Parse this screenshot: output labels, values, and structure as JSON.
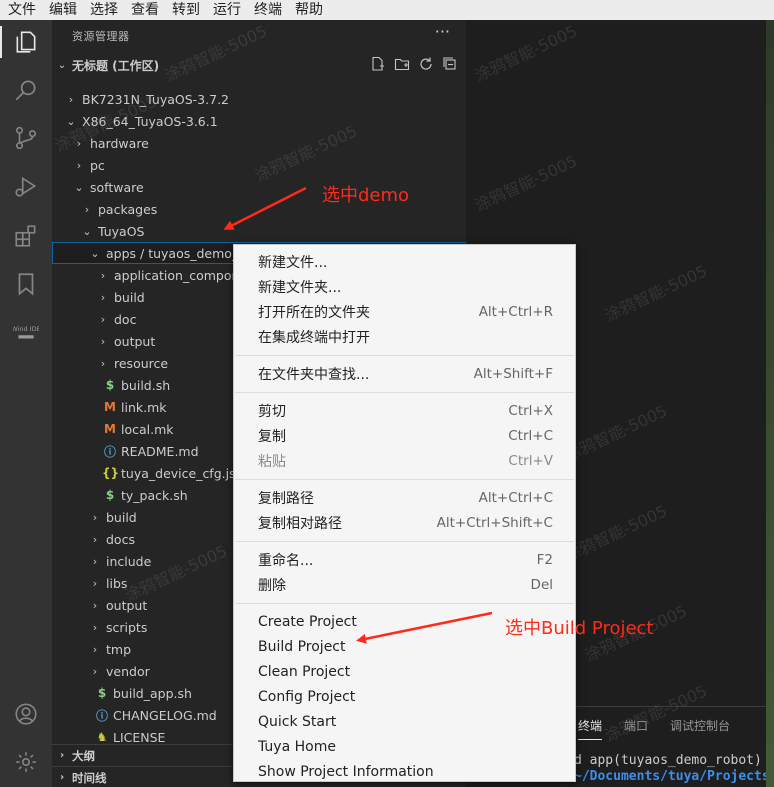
{
  "menubar": {
    "items": [
      "文件",
      "编辑",
      "选择",
      "查看",
      "转到",
      "运行",
      "终端",
      "帮助"
    ]
  },
  "activitybar": {
    "items": [
      "explorer-icon",
      "search-icon",
      "source-control-icon",
      "run-debug-icon",
      "extensions-icon",
      "bookmarks-icon",
      "wind-ide-icon",
      "account-icon",
      "settings-gear-icon"
    ],
    "wind_ide_label": "Wind IDE"
  },
  "sidebar": {
    "title": "资源管理器",
    "more": "···",
    "workspace": "无标题 (工作区)",
    "tree": [
      {
        "label": "BK7231N_TuyaOS-3.7.2",
        "chevron": "›",
        "icon": "",
        "indent": 0
      },
      {
        "label": "X86_64_TuyaOS-3.6.1",
        "chevron": "⌄",
        "icon": "",
        "indent": 0
      },
      {
        "label": "hardware",
        "chevron": "›",
        "icon": "",
        "indent": 1
      },
      {
        "label": "pc",
        "chevron": "›",
        "icon": "",
        "indent": 1
      },
      {
        "label": "software",
        "chevron": "⌄",
        "icon": "",
        "indent": 1
      },
      {
        "label": "packages",
        "chevron": "›",
        "icon": "",
        "indent": 2
      },
      {
        "label": "TuyaOS",
        "chevron": "⌄",
        "icon": "",
        "indent": 2
      },
      {
        "label": "apps / tuyaos_demo_robot",
        "chevron": "⌄",
        "icon": "",
        "indent": 3
      },
      {
        "label": "application_compor",
        "chevron": "›",
        "icon": "",
        "indent": 4
      },
      {
        "label": "build",
        "chevron": "›",
        "icon": "",
        "indent": 4
      },
      {
        "label": "doc",
        "chevron": "›",
        "icon": "",
        "indent": 4
      },
      {
        "label": "output",
        "chevron": "›",
        "icon": "",
        "indent": 4
      },
      {
        "label": "resource",
        "chevron": "›",
        "icon": "",
        "indent": 4
      },
      {
        "label": "build.sh",
        "chevron": "",
        "icon": "$",
        "indent": 4
      },
      {
        "label": "link.mk",
        "chevron": "",
        "icon": "M",
        "indent": 4
      },
      {
        "label": "local.mk",
        "chevron": "",
        "icon": "M",
        "indent": 4
      },
      {
        "label": "README.md",
        "chevron": "",
        "icon": "ⓘ",
        "indent": 4
      },
      {
        "label": "tuya_device_cfg.jso",
        "chevron": "",
        "icon": "{}",
        "indent": 4
      },
      {
        "label": "ty_pack.sh",
        "chevron": "",
        "icon": "$",
        "indent": 4
      },
      {
        "label": "build",
        "chevron": "›",
        "icon": "",
        "indent": 3
      },
      {
        "label": "docs",
        "chevron": "›",
        "icon": "",
        "indent": 3
      },
      {
        "label": "include",
        "chevron": "›",
        "icon": "",
        "indent": 3
      },
      {
        "label": "libs",
        "chevron": "›",
        "icon": "",
        "indent": 3
      },
      {
        "label": "output",
        "chevron": "›",
        "icon": "",
        "indent": 3
      },
      {
        "label": "scripts",
        "chevron": "›",
        "icon": "",
        "indent": 3
      },
      {
        "label": "tmp",
        "chevron": "›",
        "icon": "",
        "indent": 3
      },
      {
        "label": "vendor",
        "chevron": "›",
        "icon": "",
        "indent": 3
      },
      {
        "label": "build_app.sh",
        "chevron": "",
        "icon": "$",
        "indent": 3
      },
      {
        "label": "CHANGELOG.md",
        "chevron": "",
        "icon": "ⓘ",
        "indent": 3
      },
      {
        "label": "LICENSE",
        "chevron": "",
        "icon": "♞",
        "indent": 3
      }
    ],
    "panels": [
      "大纲",
      "时间线"
    ]
  },
  "panel": {
    "tabs": [
      "终端",
      "端口",
      "调试控制台"
    ],
    "terminal_line1": "d app(tuyaos_demo_robot)",
    "terminal_line2": "~/Documents/tuya/Projects"
  },
  "context_menu": {
    "groups": [
      [
        {
          "label": "新建文件...",
          "shortcut": ""
        },
        {
          "label": "新建文件夹...",
          "shortcut": ""
        },
        {
          "label": "打开所在的文件夹",
          "shortcut": "Alt+Ctrl+R"
        },
        {
          "label": "在集成终端中打开",
          "shortcut": ""
        }
      ],
      [
        {
          "label": "在文件夹中查找...",
          "shortcut": "Alt+Shift+F"
        }
      ],
      [
        {
          "label": "剪切",
          "shortcut": "Ctrl+X"
        },
        {
          "label": "复制",
          "shortcut": "Ctrl+C"
        },
        {
          "label": "粘贴",
          "shortcut": "Ctrl+V",
          "disabled": true
        }
      ],
      [
        {
          "label": "复制路径",
          "shortcut": "Alt+Ctrl+C"
        },
        {
          "label": "复制相对路径",
          "shortcut": "Alt+Ctrl+Shift+C"
        }
      ],
      [
        {
          "label": "重命名...",
          "shortcut": "F2"
        },
        {
          "label": "删除",
          "shortcut": "Del"
        }
      ],
      [
        {
          "label": "Create Project",
          "shortcut": ""
        },
        {
          "label": "Build Project",
          "shortcut": ""
        },
        {
          "label": "Clean Project",
          "shortcut": ""
        },
        {
          "label": "Config Project",
          "shortcut": ""
        },
        {
          "label": "Quick Start",
          "shortcut": ""
        },
        {
          "label": "Tuya Home",
          "shortcut": ""
        },
        {
          "label": "Show Project Information",
          "shortcut": ""
        }
      ]
    ]
  },
  "annotations": {
    "select_demo": "选中demo",
    "select_build": "选中Build Project"
  },
  "watermark": "涂鸦智能-5005",
  "colors": {
    "annotation": "#ff2a1a",
    "selection_border": "#0e639c",
    "sidebar_bg": "#252526",
    "activity_bg": "#333333",
    "menu_bg": "#f5f5f5"
  }
}
